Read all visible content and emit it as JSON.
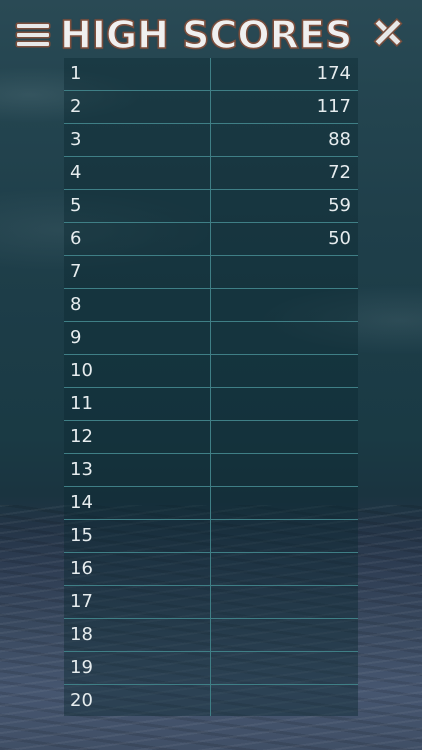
{
  "header": {
    "title": "HIGH SCORES",
    "menu_icon": "hamburger-menu-icon",
    "close_icon": "close-x-icon"
  },
  "colors": {
    "title_fill": "#f0f0f0",
    "title_outline": "#7d4f3d",
    "table_line": "#3f7f86",
    "text": "#e6ecee"
  },
  "scores": [
    {
      "rank": "1",
      "score": "174"
    },
    {
      "rank": "2",
      "score": "117"
    },
    {
      "rank": "3",
      "score": "88"
    },
    {
      "rank": "4",
      "score": "72"
    },
    {
      "rank": "5",
      "score": "59"
    },
    {
      "rank": "6",
      "score": "50"
    },
    {
      "rank": "7",
      "score": ""
    },
    {
      "rank": "8",
      "score": ""
    },
    {
      "rank": "9",
      "score": ""
    },
    {
      "rank": "10",
      "score": ""
    },
    {
      "rank": "11",
      "score": ""
    },
    {
      "rank": "12",
      "score": ""
    },
    {
      "rank": "13",
      "score": ""
    },
    {
      "rank": "14",
      "score": ""
    },
    {
      "rank": "15",
      "score": ""
    },
    {
      "rank": "16",
      "score": ""
    },
    {
      "rank": "17",
      "score": ""
    },
    {
      "rank": "18",
      "score": ""
    },
    {
      "rank": "19",
      "score": ""
    },
    {
      "rank": "20",
      "score": ""
    }
  ]
}
